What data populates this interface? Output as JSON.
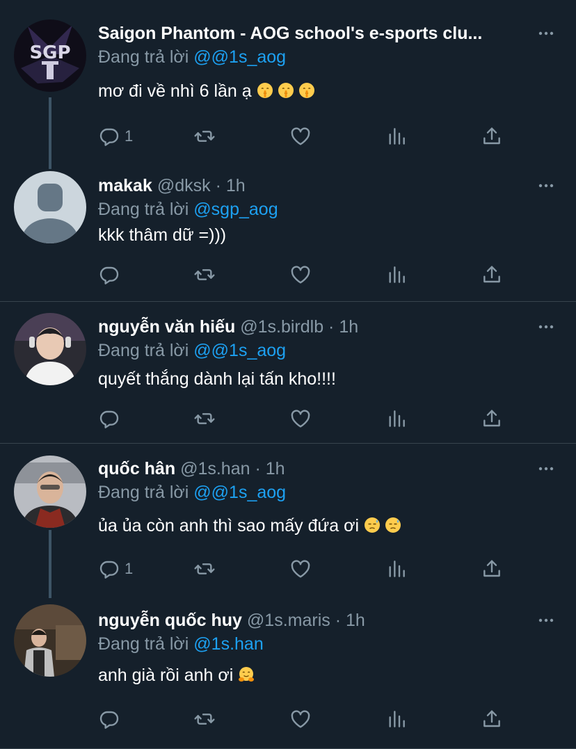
{
  "reply_prefix": "Đang trả lời",
  "tweets": [
    {
      "name": "Saigon Phantom - AOG school's e-sports clu...",
      "handle": "",
      "dot": "",
      "time": "",
      "reply_to": "@@1s_aog",
      "text": "mơ đi về nhì 6 lần ạ",
      "emoji": [
        "shushing-face",
        "shushing-face",
        "shushing-face"
      ],
      "reply_count": "1",
      "avatar": "sgp-logo"
    },
    {
      "name": "makak",
      "handle": "@dksk",
      "dot": "·",
      "time": "1h",
      "reply_to": "@sgp_aog",
      "text": "kkk thâm dữ =)))",
      "emoji": [],
      "reply_count": "",
      "avatar": "default-avatar"
    },
    {
      "name": "nguyễn văn hiếu",
      "handle": "@1s.birdlb",
      "dot": "·",
      "time": "1h",
      "reply_to": "@@1s_aog",
      "text": "quyết thắng dành lại tấn kho!!!!",
      "emoji": [],
      "reply_count": "",
      "avatar": "photo-avatar"
    },
    {
      "name": "quốc hân",
      "handle": "@1s.han",
      "dot": "·",
      "time": "1h",
      "reply_to": "@@1s_aog",
      "text": "ủa ủa còn anh thì sao mấy đứa ơi",
      "emoji": [
        "downcast-sweat-face",
        "downcast-sweat-face"
      ],
      "reply_count": "1",
      "avatar": "photo-avatar"
    },
    {
      "name": "nguyễn quốc huy",
      "handle": "@1s.maris",
      "dot": "·",
      "time": "1h",
      "reply_to": "@1s.han",
      "text": "anh già rồi anh ơi",
      "emoji": [
        "hugging-face"
      ],
      "reply_count": "",
      "avatar": "photo-avatar"
    }
  ],
  "colors": {
    "background": "#15202b",
    "divider": "#38444d",
    "secondary_text": "#8899a6",
    "link": "#1da1f2",
    "thread_line": "#3d5466"
  }
}
